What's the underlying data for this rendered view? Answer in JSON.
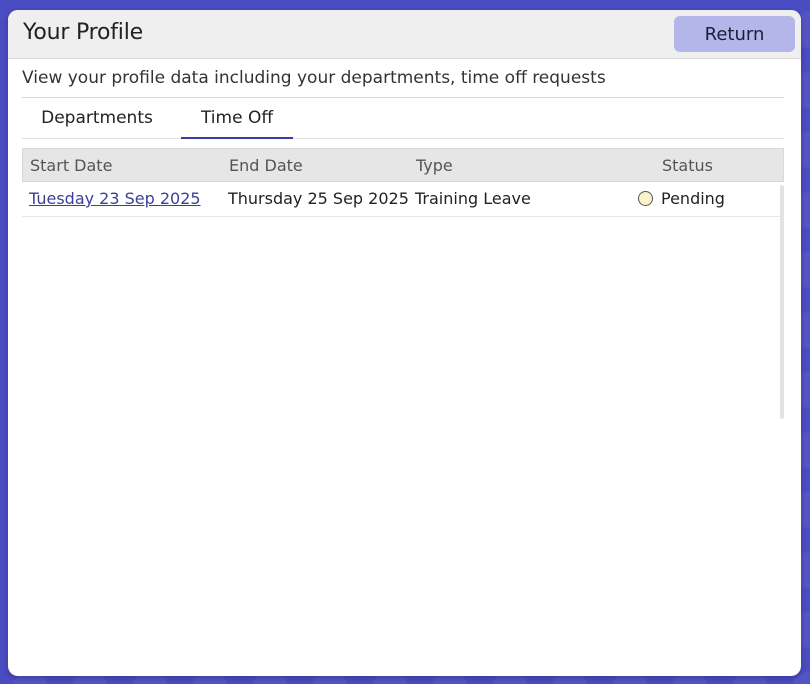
{
  "header": {
    "title": "Your Profile",
    "return_label": "Return"
  },
  "description": "View your profile data including your departments, time off requests",
  "tabs": [
    {
      "label": "Departments",
      "active": false
    },
    {
      "label": "Time Off",
      "active": true
    }
  ],
  "table": {
    "columns": [
      "Start Date",
      "End Date",
      "Type",
      "Status"
    ],
    "rows": [
      {
        "start_date": "Tuesday 23 Sep 2025",
        "end_date": "Thursday 25 Sep 2025",
        "type": "Training Leave",
        "status": "Pending",
        "status_icon": "pending-circle-icon"
      }
    ]
  },
  "colors": {
    "background": "#4a4cc2",
    "accent": "#3a3d9c",
    "return_button": "#b4b6ea",
    "pending_status": "#fbf3c9"
  }
}
